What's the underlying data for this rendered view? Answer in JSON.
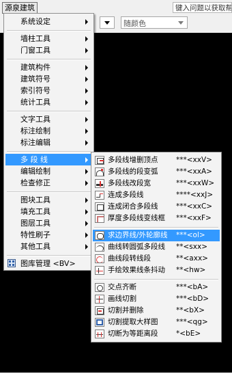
{
  "app": {
    "title": "源泉建筑",
    "help_search_placeholder": "键入问题以获取帮助",
    "color_combo_value": "随颜色"
  },
  "main_menu": {
    "items": [
      {
        "label": "系统设定",
        "has_submenu": true
      },
      {
        "label": "墙柱工具",
        "has_submenu": true
      },
      {
        "label": "门窗工具",
        "has_submenu": true
      },
      {
        "label": "建筑构件",
        "has_submenu": true
      },
      {
        "label": "建筑符号",
        "has_submenu": true
      },
      {
        "label": "索引符号",
        "has_submenu": true
      },
      {
        "label": "统计工具",
        "has_submenu": true
      },
      {
        "label": "文字工具",
        "has_submenu": true
      },
      {
        "label": "标注绘制",
        "has_submenu": true
      },
      {
        "label": "标注编辑",
        "has_submenu": true
      },
      {
        "label": "多 段 线",
        "has_submenu": true,
        "active": true
      },
      {
        "label": "编辑绘制",
        "has_submenu": true
      },
      {
        "label": "检查修正",
        "has_submenu": true
      },
      {
        "label": "图块工具",
        "has_submenu": true
      },
      {
        "label": "填充工具",
        "has_submenu": true
      },
      {
        "label": "图层工具",
        "has_submenu": true
      },
      {
        "label": "特性刷子",
        "has_submenu": true
      },
      {
        "label": "其他工具",
        "has_submenu": true
      },
      {
        "label": "图库管理 <BV>",
        "has_submenu": false
      }
    ]
  },
  "sub_menu": {
    "items": [
      {
        "label": "多段线增删顶点",
        "shortcut": "***<xxV>",
        "icon": "add-remove-vertex-icon"
      },
      {
        "label": "多段线的段变弧",
        "shortcut": "***<xxA>",
        "icon": "segment-to-arc-icon"
      },
      {
        "label": "多段线改段宽",
        "shortcut": "***<xxW>",
        "icon": "segment-width-icon"
      },
      {
        "label": "连成多段线",
        "shortcut": "****<xxJ>",
        "icon": "join-polyline-icon"
      },
      {
        "label": "连成闭合多段线",
        "shortcut": "***<xxC>",
        "icon": "close-polyline-icon"
      },
      {
        "label": "厚度多段线变线框",
        "shortcut": "***<xxF>",
        "icon": "thickness-frame-icon"
      },
      {
        "label": "求边界线/外轮廓线",
        "shortcut": "***<ol>",
        "icon": "boundary-outline-icon",
        "active": true
      },
      {
        "label": "曲线转圆弧多段线",
        "shortcut": "**<sxx>",
        "icon": "curve-to-arc-icon"
      },
      {
        "label": "曲线段转线段",
        "shortcut": "**<axx>",
        "icon": "curve-to-line-icon"
      },
      {
        "label": "手绘效果线条抖动",
        "shortcut": "**<hw>",
        "icon": "hand-draw-jitter-icon"
      },
      {
        "label": "交点齐断",
        "shortcut": "***<bA>",
        "icon": "break-at-intersection-icon"
      },
      {
        "label": "画线切割",
        "shortcut": "***<bD>",
        "icon": "line-cut-icon"
      },
      {
        "label": "切割并删除",
        "shortcut": "**<bX>",
        "icon": "cut-delete-icon"
      },
      {
        "label": "切割提取大样图",
        "shortcut": "***<qg>",
        "icon": "cut-extract-detail-icon"
      },
      {
        "label": "切断为等距离段",
        "shortcut": "*<bE>",
        "icon": "equal-divide-icon"
      }
    ]
  },
  "colors": {
    "highlight": "#3399ff",
    "menu_bg": "#f3f3f3",
    "canvas": "#000000"
  }
}
